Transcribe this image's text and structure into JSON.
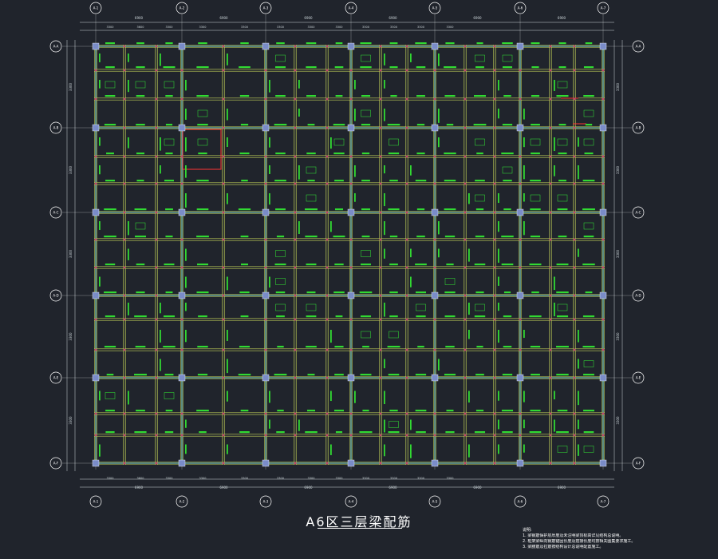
{
  "drawing": {
    "title": "A6区三层梁配筋",
    "grid_col_labels": [
      "A-1",
      "A-2",
      "A-3",
      "A-4",
      "A-5",
      "A-6",
      "A-7"
    ],
    "grid_row_labels": [
      "A-A",
      "A-B",
      "A-C",
      "A-D",
      "A-E",
      "A-F"
    ],
    "top_dims_upper": [
      "6900",
      "6900",
      "6900",
      "6900",
      "6900",
      "6900",
      "3475"
    ],
    "top_dims_lower": [
      "3300",
      "3600",
      "3300",
      "3300",
      "3300",
      "3300",
      "3300",
      "3300",
      "3300",
      "3300",
      "3300",
      "3300"
    ],
    "bottom_dims_upper": [
      "3300",
      "3600",
      "3300",
      "3300",
      "3300",
      "3300",
      "3300",
      "3300",
      "3300",
      "3300",
      "3300",
      "3300"
    ],
    "bottom_dims_lower": [
      "6900",
      "6900",
      "6900",
      "6900",
      "6900",
      "6900",
      "3475"
    ],
    "side_dims": [
      "3300",
      "3300",
      "3300",
      "3300",
      "3300"
    ],
    "notes_heading": "说明:",
    "notes": [
      "1. 梁钢筋保护层厚度及未注明梁顶标高详见结构总说明。",
      "2. 框架梁纵向钢筋锚固长度及搭接长度均按相关图集要求施工。",
      "3. 梁腰筋及拉筋按结构设计总说明配置施工。"
    ]
  },
  "colors": {
    "background": "#20242c",
    "grid_line": "#ffffff",
    "beam_line": "#c8d85a",
    "column_fill": "#7a8cc8",
    "annotation": "#33ee33",
    "dimension": "#cfd8dc",
    "axis_bubble": "#ffffff",
    "highlight": "#ff3333"
  }
}
